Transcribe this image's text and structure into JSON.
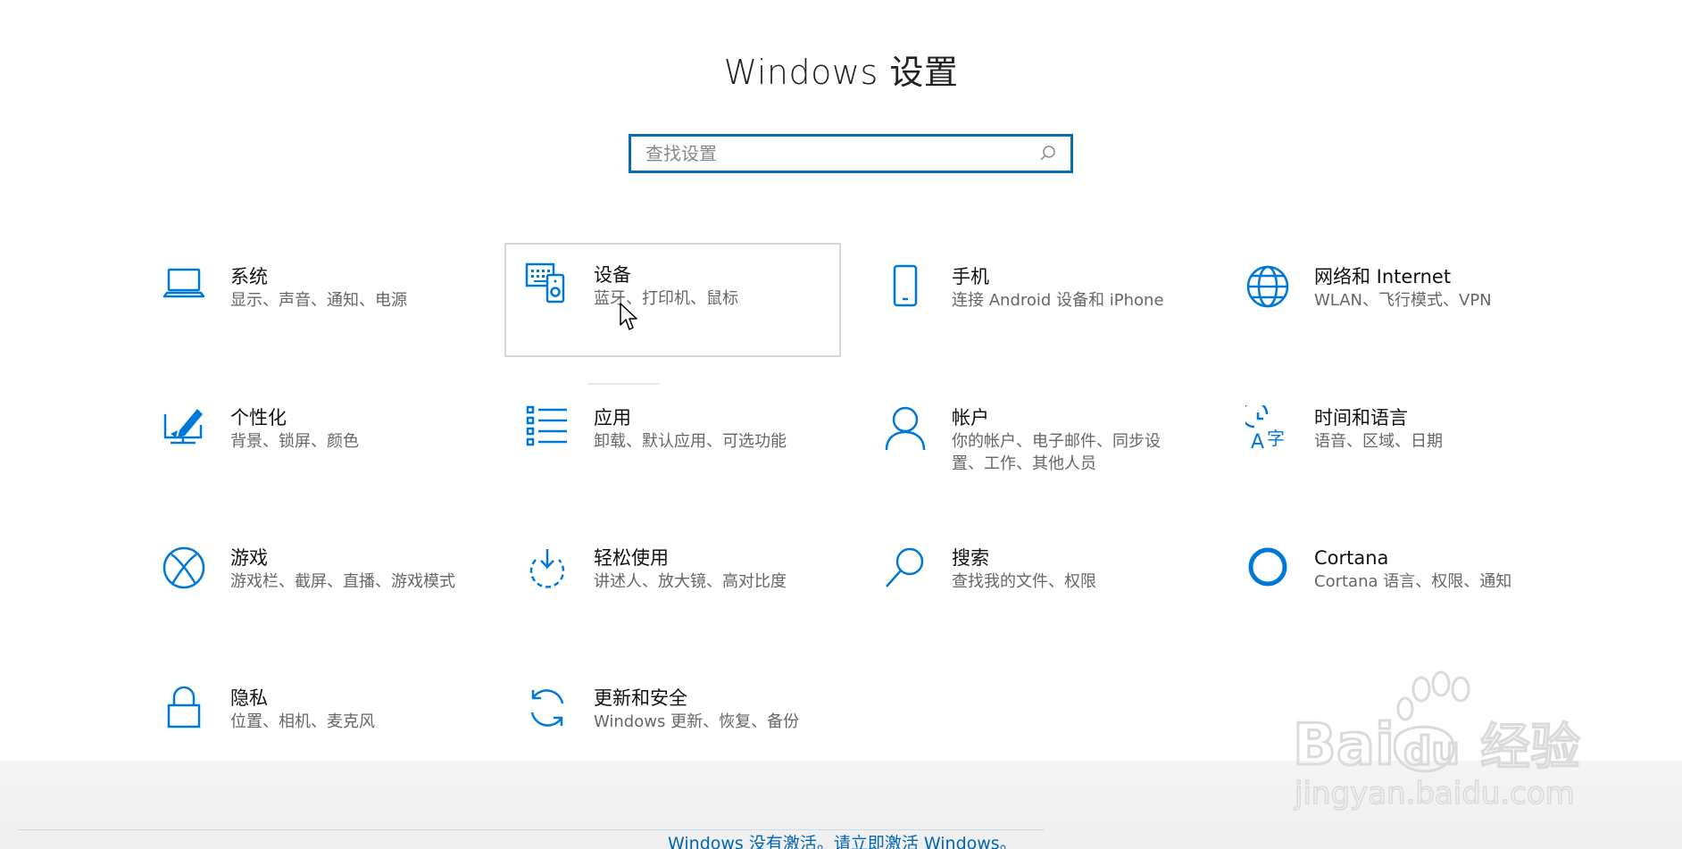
{
  "page": {
    "title": "Windows 设置"
  },
  "search": {
    "placeholder": "查找设置",
    "value": ""
  },
  "items": [
    {
      "id": "system",
      "title": "系统",
      "desc": "显示、声音、通知、电源",
      "icon": "laptop-icon"
    },
    {
      "id": "devices",
      "title": "设备",
      "desc": "蓝牙、打印机、鼠标",
      "icon": "devices-icon"
    },
    {
      "id": "phone",
      "title": "手机",
      "desc": "连接 Android 设备和 iPhone",
      "icon": "phone-icon"
    },
    {
      "id": "network",
      "title": "网络和 Internet",
      "desc": "WLAN、飞行模式、VPN",
      "icon": "globe-icon"
    },
    {
      "id": "personalization",
      "title": "个性化",
      "desc": "背景、锁屏、颜色",
      "icon": "personalization-icon"
    },
    {
      "id": "apps",
      "title": "应用",
      "desc": "卸载、默认应用、可选功能",
      "icon": "apps-list-icon"
    },
    {
      "id": "accounts",
      "title": "帐户",
      "desc": "你的帐户、电子邮件、同步设\n置、工作、其他人员",
      "icon": "person-icon"
    },
    {
      "id": "time-language",
      "title": "时间和语言",
      "desc": "语音、区域、日期",
      "icon": "time-language-icon"
    },
    {
      "id": "gaming",
      "title": "游戏",
      "desc": "游戏栏、截屏、直播、游戏模式",
      "icon": "xbox-icon"
    },
    {
      "id": "ease-of-access",
      "title": "轻松使用",
      "desc": "讲述人、放大镜、高对比度",
      "icon": "ease-of-access-icon"
    },
    {
      "id": "search",
      "title": "搜索",
      "desc": "查找我的文件、权限",
      "icon": "magnifier-icon"
    },
    {
      "id": "cortana",
      "title": "Cortana",
      "desc": "Cortana 语言、权限、通知",
      "icon": "cortana-ring-icon"
    },
    {
      "id": "privacy",
      "title": "隐私",
      "desc": "位置、相机、麦克风",
      "icon": "lock-icon"
    },
    {
      "id": "update-security",
      "title": "更新和安全",
      "desc": "Windows 更新、恢复、备份",
      "icon": "refresh-icon"
    }
  ],
  "activation": {
    "text": "Windows 没有激活。请立即激活 Windows。"
  },
  "watermark": {
    "brand": "Bai du 经验",
    "url": "jingyan.baidu.com"
  },
  "colors": {
    "accent": "#0a6cb0",
    "icon_blue": "#0078d7",
    "activation_link": "#0066b4"
  }
}
